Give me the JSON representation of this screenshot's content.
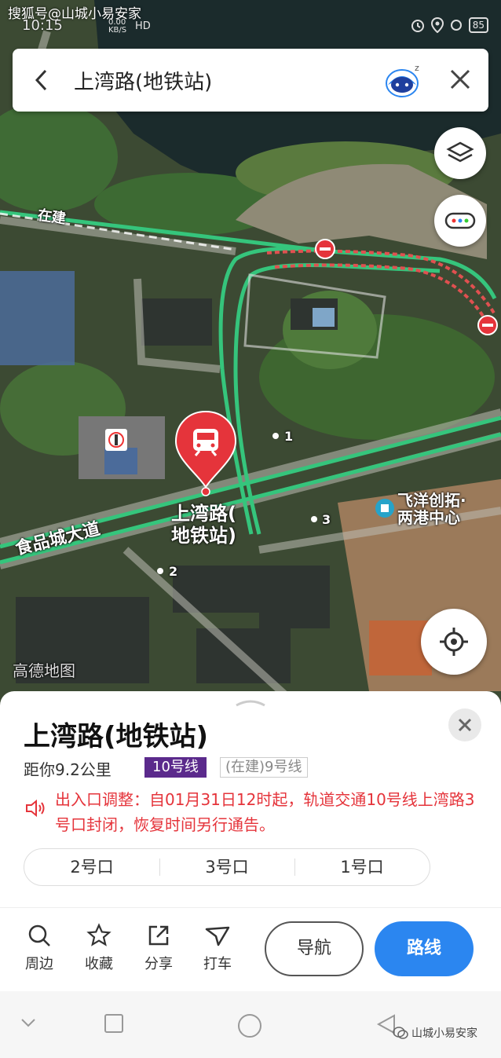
{
  "status_bar": {
    "watermark": "搜狐号@山城小易安家",
    "time": "10:15",
    "net_speed": "0.00 KB/S",
    "hd": "HD",
    "battery": "85"
  },
  "search": {
    "title": "上湾路(地铁站)"
  },
  "map": {
    "labels": {
      "road_in_construction": "在建",
      "road_main": "食品城大道",
      "station": "上湾路(\n地铁站)",
      "poi_feiyang": "飞洋创拓·\n两港中心",
      "exit_1": "1",
      "exit_2": "2",
      "exit_3": "3",
      "amap_logo": "高德地图"
    }
  },
  "sheet": {
    "title": "上湾路(地铁站)",
    "distance": "距你9.2公里",
    "line_badge": "10号线",
    "line_badge2": "(在建)9号线",
    "notice": "出入口调整：自01月31日12时起，轨道交通10号线上湾路3号口封闭，恢复时间另行通告。",
    "exits": [
      "2号口",
      "3号口",
      "1号口"
    ],
    "actions": {
      "nearby": "周边",
      "favorite": "收藏",
      "share": "分享",
      "taxi": "打车"
    },
    "navigate": "导航",
    "route": "路线"
  },
  "watermark_bottom": "山城小易安家",
  "colors": {
    "accent_blue": "#2b86f0",
    "line10_purple": "#5b2a8c",
    "notice_red": "#e5343b",
    "station_red": "#e5343b"
  }
}
